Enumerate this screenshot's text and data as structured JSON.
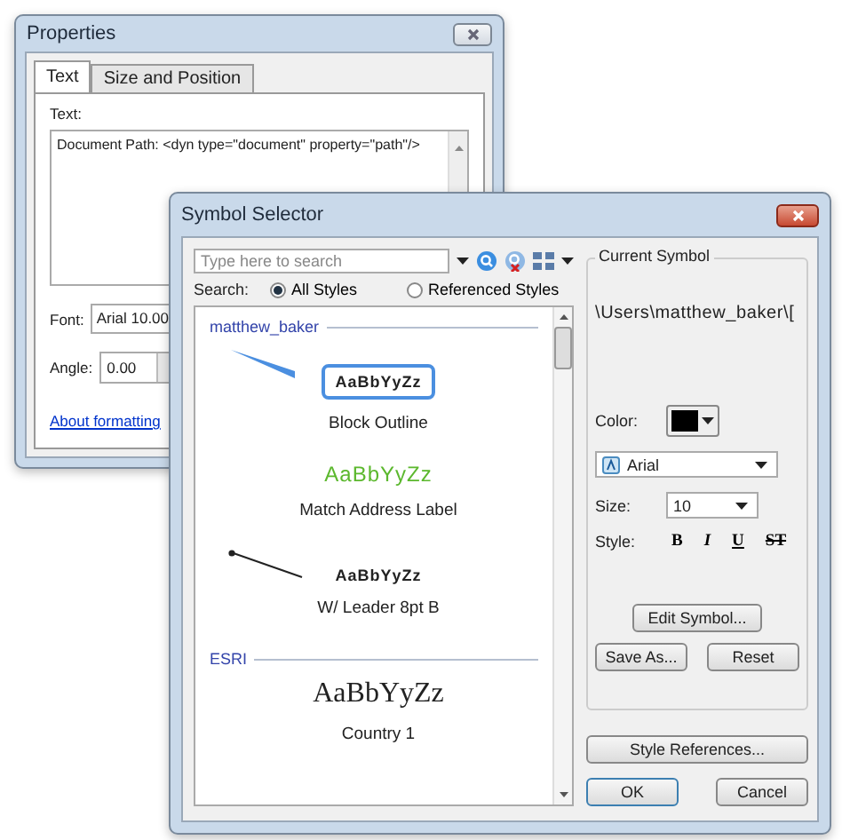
{
  "properties_window": {
    "title": "Properties",
    "tabs": [
      {
        "label": "Text",
        "selected": true
      },
      {
        "label": "Size and Position",
        "selected": false
      }
    ],
    "text_label": "Text:",
    "text_value": "Document Path: <dyn type=\"document\" property=\"path\"/>",
    "font_label": "Font:",
    "font_value": "Arial 10.00",
    "angle_label": "Angle:",
    "angle_value": "0.00",
    "link": "About formatting"
  },
  "symbol_selector": {
    "title": "Symbol Selector",
    "search": {
      "placeholder": "Type here to search"
    },
    "search_label": "Search:",
    "scopes": [
      {
        "label": "All Styles",
        "selected": true
      },
      {
        "label": "Referenced Styles",
        "selected": false
      }
    ],
    "groups": [
      {
        "name": "matthew_baker",
        "symbols": [
          {
            "kind": "callout",
            "sample": "AaBbYyZz",
            "name": "Block Outline"
          },
          {
            "kind": "colored",
            "color": "#5cb82e",
            "sample": "AaBbYyZz",
            "name": "Match Address Label"
          },
          {
            "kind": "leader",
            "sample": "AaBbYyZz",
            "name": "W/ Leader 8pt B"
          }
        ]
      },
      {
        "name": "ESRI",
        "symbols": [
          {
            "kind": "serif",
            "sample": "AaBbYyZz",
            "name": "Country 1"
          }
        ]
      }
    ],
    "current_symbol": {
      "heading": "Current Symbol",
      "preview": "\\Users\\matthew_baker\\[",
      "color_label": "Color:",
      "color": "#000000",
      "font": "Arial",
      "size_label": "Size:",
      "size": "10",
      "style_label": "Style:",
      "style_buttons": [
        {
          "kind": "bold",
          "label": "B"
        },
        {
          "kind": "italic",
          "label": "I"
        },
        {
          "kind": "underline",
          "label": "U"
        },
        {
          "kind": "strike",
          "label": "ST"
        }
      ],
      "edit_button": "Edit Symbol...",
      "save_button": "Save As...",
      "reset_button": "Reset"
    },
    "style_references_button": "Style References...",
    "buttons": [
      "OK",
      "Cancel"
    ]
  }
}
